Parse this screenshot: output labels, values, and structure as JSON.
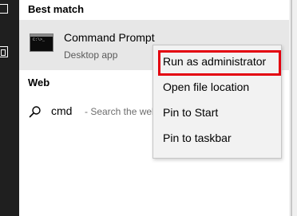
{
  "sections": {
    "best_match": "Best match",
    "web": "Web"
  },
  "best_match_item": {
    "title": "Command Prompt",
    "subtitle": "Desktop app",
    "icon": "command-prompt-icon",
    "icon_glyph": "C:\\>_"
  },
  "web_result": {
    "icon": "search-icon",
    "query": "cmd",
    "hint": "- Search the web"
  },
  "context_menu": {
    "items": [
      {
        "label": "Run as administrator",
        "highlighted": true
      },
      {
        "label": "Open file location"
      },
      {
        "label": "Pin to Start"
      },
      {
        "label": "Pin to taskbar"
      }
    ]
  },
  "colors": {
    "highlight_border": "#e3000f",
    "selected_item_bg": "#e7e7e7",
    "menu_bg": "#f2f2f2",
    "left_rail_bg": "#1f1f1f"
  }
}
